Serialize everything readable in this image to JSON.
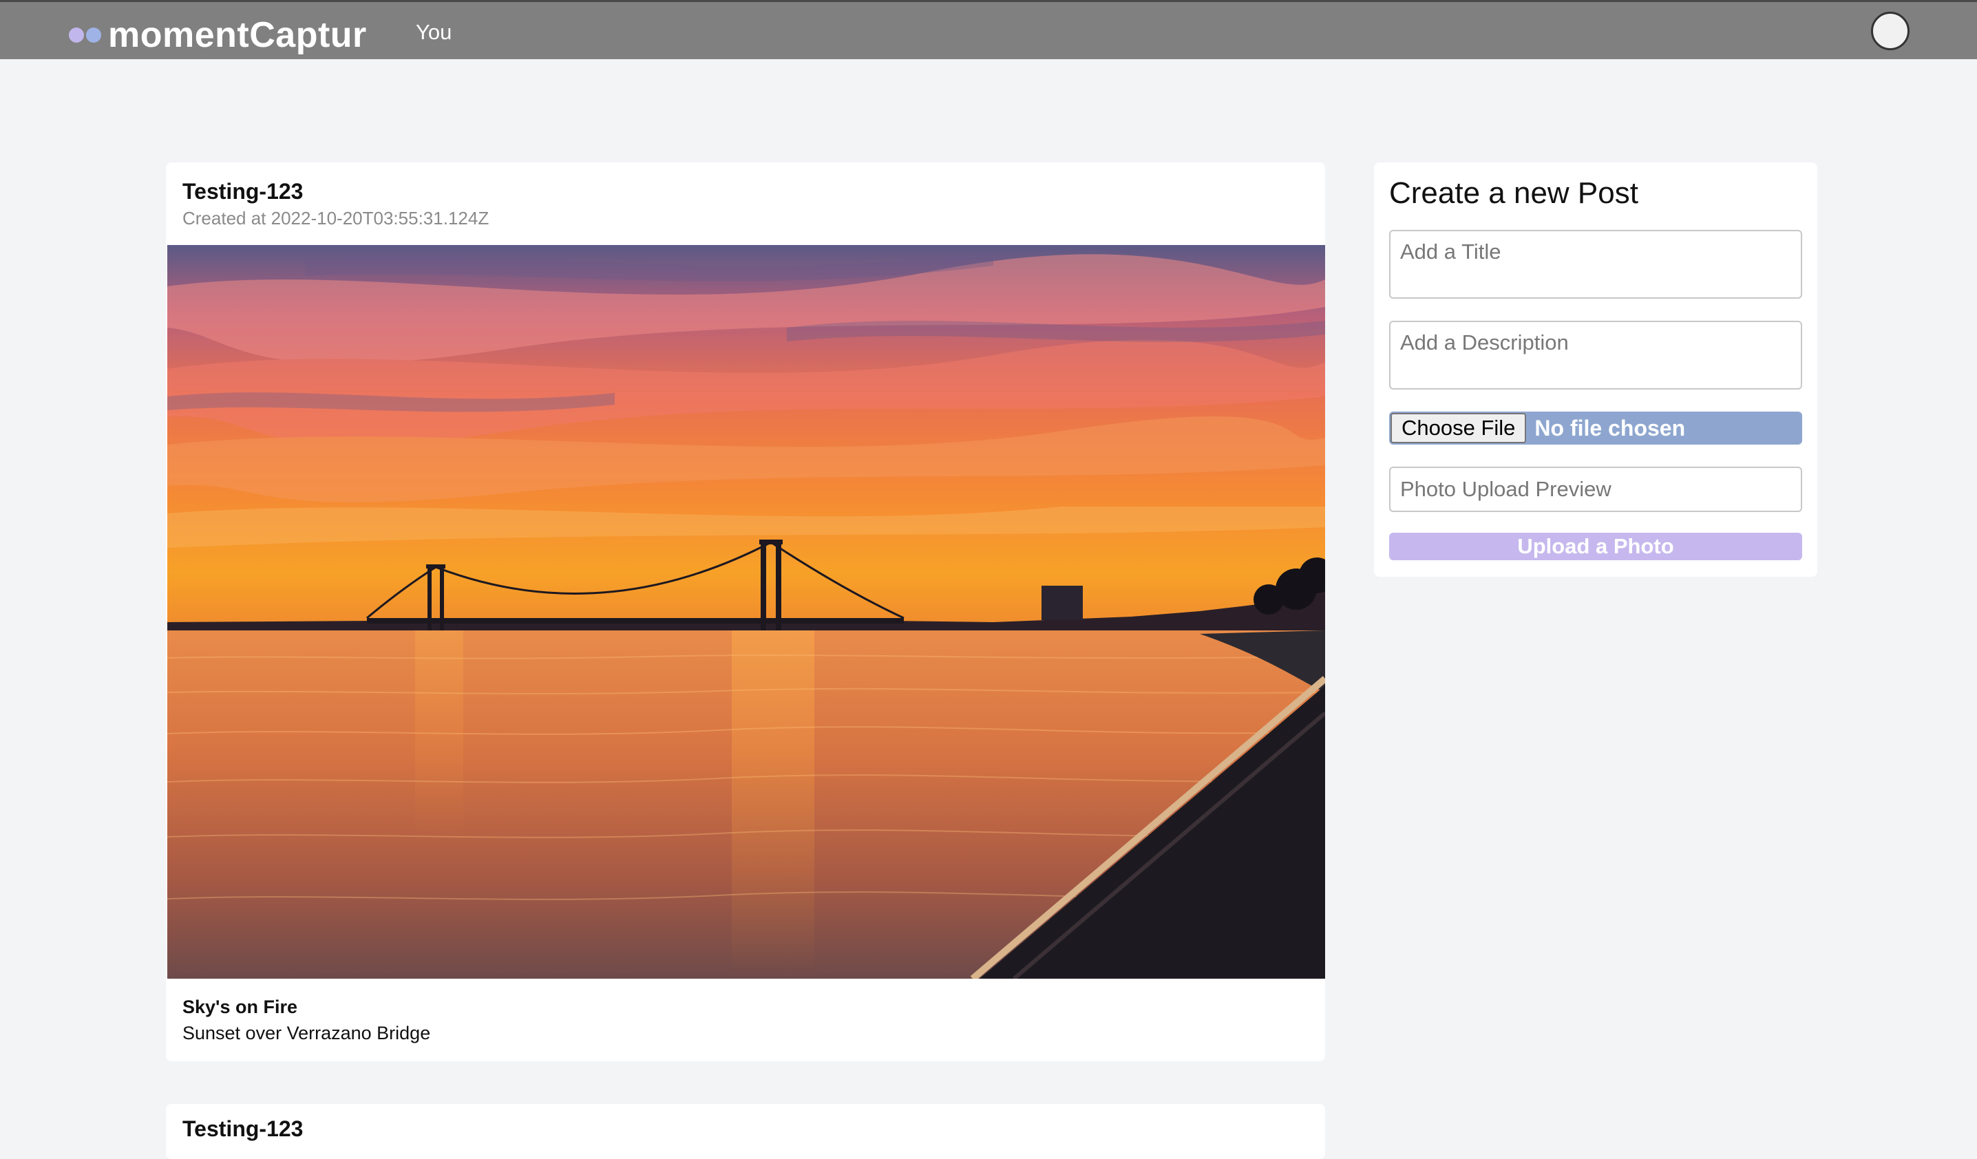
{
  "brand": {
    "name": "momentCaptur"
  },
  "nav": {
    "you_label": "You"
  },
  "posts": [
    {
      "title": "Testing-123",
      "created": "Created at 2022-10-20T03:55:31.124Z",
      "caption_title": "Sky's on Fire",
      "caption_desc": "Sunset over Verrazano Bridge"
    },
    {
      "title": "Testing-123"
    }
  ],
  "create": {
    "heading": "Create a new Post",
    "title_placeholder": "Add a Title",
    "desc_placeholder": "Add a Description",
    "choose_file_label": "Choose File",
    "no_file_label": "No file chosen",
    "preview_placeholder": "Photo Upload Preview",
    "upload_label": "Upload a Photo"
  },
  "colors": {
    "navbar": "#808080",
    "page_bg": "#f3f4f6",
    "file_row": "#8ea6cf",
    "upload_button": "#c6b8ee",
    "logo_dot_1": "#c2b7ec",
    "logo_dot_2": "#9fb3e6"
  }
}
